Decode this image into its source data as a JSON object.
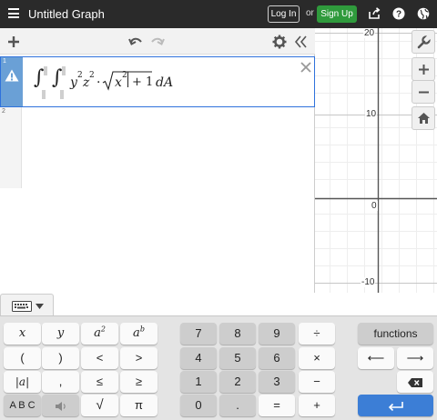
{
  "app": {
    "title": "Untitled Graph",
    "login_label": "Log In",
    "or_label": "or",
    "signup_label": "Sign Up"
  },
  "colors": {
    "topbar": "#2a2a2a",
    "signup": "#2f9a3c",
    "active_row_tab": "#6aa0d6",
    "active_row_border": "#2f72dc",
    "enter_key": "#3c7ed6"
  },
  "icons": {
    "menu": "hamburger-icon",
    "share": "share-icon",
    "help": "help-icon",
    "language": "globe-icon",
    "add": "plus-icon",
    "undo": "undo-icon",
    "redo": "redo-icon",
    "settings": "gear-icon",
    "collapse": "double-chevron-left-icon",
    "warning": "warning-icon",
    "delete": "close-icon",
    "wrench": "wrench-icon",
    "zoom_in": "zoom-in-icon",
    "zoom_out": "zoom-out-icon",
    "home": "home-icon",
    "keyboard": "keyboard-icon"
  },
  "expressions": [
    {
      "number": "1",
      "latex_text": "∫∫ y²z² · √(x²+1) dA",
      "has_warning": true
    },
    {
      "number": "2",
      "latex_text": ""
    }
  ],
  "formula": {
    "integral": "∫",
    "y": "y",
    "y_exp": "2",
    "z": "z",
    "z_exp": "2",
    "dot": "·",
    "x": "x",
    "x_exp": "2",
    "plus_one": "+ 1",
    "dA": "dA"
  },
  "graph": {
    "y_ticks": [
      "20",
      "10",
      "0",
      "-10"
    ],
    "x_zero_label": "0"
  },
  "keyboard": {
    "left_keys": [
      [
        "x",
        "y",
        "a2",
        "ab"
      ],
      [
        "(",
        ")",
        "<",
        ">"
      ],
      [
        "|a|",
        ",",
        "≤",
        "≥"
      ],
      [
        "ABC",
        "audio",
        "√",
        "π"
      ]
    ],
    "a_base": "a",
    "a_sq_exp": "2",
    "b_exp": "b",
    "abs_label": "|a|",
    "abc_label": "A B C",
    "sqrt_label": "√",
    "pi_label": "π",
    "numpad": [
      [
        "7",
        "8",
        "9",
        "÷"
      ],
      [
        "4",
        "5",
        "6",
        "×"
      ],
      [
        "1",
        "2",
        "3",
        "−"
      ],
      [
        "0",
        ".",
        "=",
        "+"
      ]
    ],
    "functions_label": "functions",
    "left_arrow": "⟵",
    "right_arrow": "⟶"
  }
}
